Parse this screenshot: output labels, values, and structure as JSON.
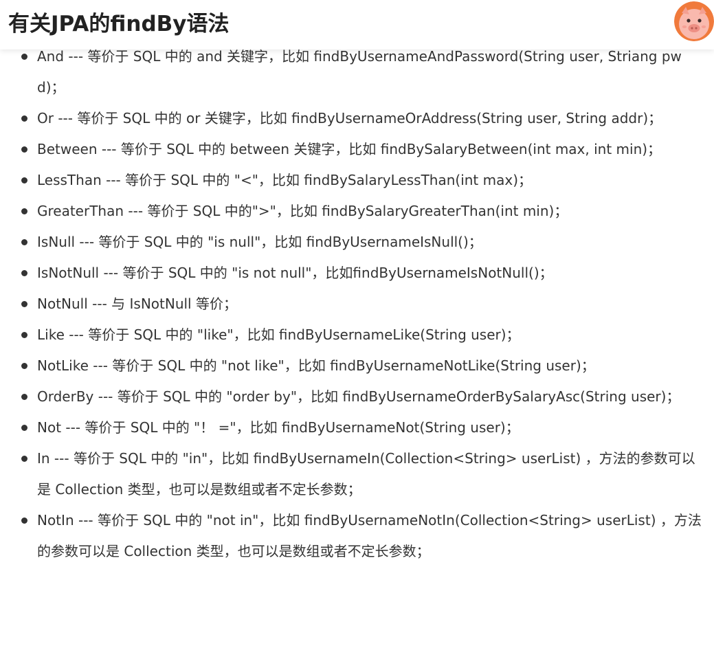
{
  "header": {
    "title": "有关JPA的findBy语法"
  },
  "colors": {
    "avatar_bg": "#f07a3c",
    "pig_pink": "#f9b9ae",
    "text": "#333333"
  },
  "items": [
    "And --- 等价于 SQL 中的 and 关键字，比如 findByUsernameAndPassword(String user, Striang pwd)；",
    "Or --- 等价于 SQL 中的 or 关键字，比如 findByUsernameOrAddress(String user, String addr)；",
    "Between --- 等价于 SQL 中的 between 关键字，比如 findBySalaryBetween(int max, int min)；",
    "LessThan --- 等价于 SQL 中的 \"<\"，比如 findBySalaryLessThan(int max)；",
    "GreaterThan --- 等价于 SQL 中的\">\"，比如 findBySalaryGreaterThan(int min)；",
    "IsNull --- 等价于 SQL 中的 \"is null\"，比如 findByUsernameIsNull()；",
    "IsNotNull --- 等价于 SQL 中的 \"is not null\"，比如findByUsernameIsNotNull()；",
    "NotNull --- 与 IsNotNull 等价；",
    "Like --- 等价于 SQL 中的 \"like\"，比如 findByUsernameLike(String user)；",
    "NotLike --- 等价于 SQL 中的 \"not like\"，比如 findByUsernameNotLike(String user)；",
    "OrderBy --- 等价于 SQL 中的 \"order by\"，比如 findByUsernameOrderBySalaryAsc(String user)；",
    "Not --- 等价于 SQL 中的 \"！ =\"，比如 findByUsernameNot(String user)；",
    "In --- 等价于 SQL 中的 \"in\"，比如 findByUsernameIn(Collection<String> userList) ，方法的参数可以是 Collection 类型，也可以是数组或者不定长参数；",
    "NotIn --- 等价于 SQL 中的 \"not in\"，比如 findByUsernameNotIn(Collection<String> userList) ，方法的参数可以是 Collection 类型，也可以是数组或者不定长参数；"
  ]
}
